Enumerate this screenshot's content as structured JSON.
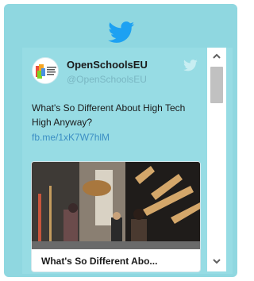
{
  "widget": {
    "header_icon": "twitter-bird-icon",
    "brand_color": "#1da1f2",
    "background_color": "#8fd7e0"
  },
  "tweet": {
    "author_name": "OpenSchoolsEU",
    "author_handle": "@OpenSchoolsEU",
    "avatar_icon": "open-schools-logo",
    "avatar_logo_text": "Open Schools for Open Societies",
    "text": "What's So Different About High Tech High Anyway?",
    "link": "fb.me/1xK7W7hlM",
    "card": {
      "title": "What's So Different Abo..."
    }
  },
  "scrollbar": {
    "up_icon": "chevron-up-icon",
    "down_icon": "chevron-down-icon"
  }
}
